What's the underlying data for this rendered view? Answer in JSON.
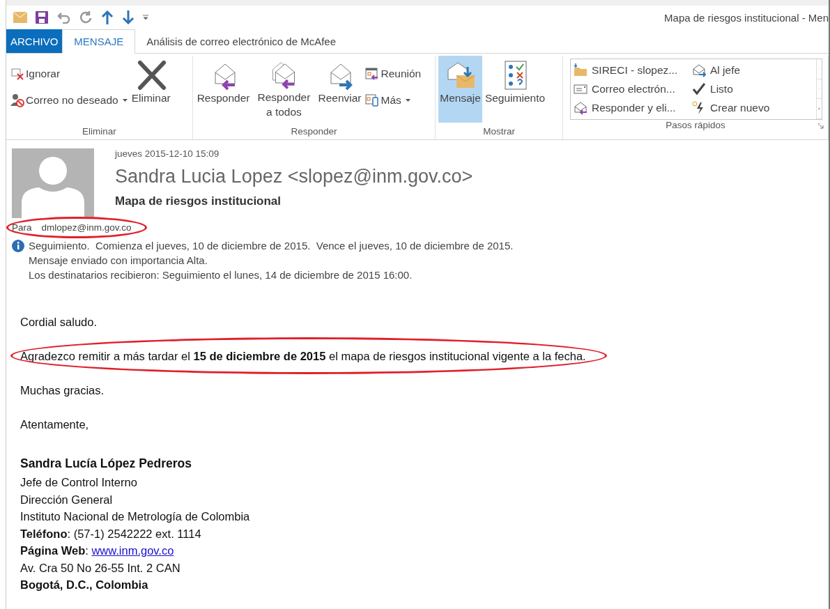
{
  "window": {
    "title": "Mapa de riesgos institucional - Men"
  },
  "tabs": [
    {
      "label": "ARCHIVO",
      "kind": "file",
      "selected": false
    },
    {
      "label": "MENSAJE",
      "kind": "tab",
      "selected": true
    },
    {
      "label": "Análisis de correo electrónico de McAfee",
      "kind": "tab",
      "selected": false
    }
  ],
  "ribbon": {
    "groups": [
      {
        "label": "Eliminar",
        "kind": "buttons",
        "buttons": [
          {
            "kind": "small",
            "label": "Ignorar",
            "dropdown": false
          },
          {
            "kind": "small",
            "label": "Correo no deseado",
            "dropdown": true
          },
          {
            "kind": "large",
            "label": "Eliminar",
            "selected": false
          }
        ]
      },
      {
        "label": "Responder",
        "kind": "buttons",
        "buttons": [
          {
            "kind": "large",
            "label": "Responder",
            "selected": false
          },
          {
            "kind": "large",
            "label": "Responder a todos",
            "selected": false
          },
          {
            "kind": "large",
            "label": "Reenviar",
            "selected": false
          },
          {
            "kind": "small",
            "label": "Reunión",
            "dropdown": false
          },
          {
            "kind": "small",
            "label": "Más",
            "dropdown": true
          }
        ]
      },
      {
        "label": "Mostrar",
        "kind": "buttons",
        "buttons": [
          {
            "kind": "large",
            "label": "Mensaje",
            "selected": true
          },
          {
            "kind": "large",
            "label": "Seguimiento",
            "selected": false
          }
        ]
      },
      {
        "label": "Pasos rápidos",
        "kind": "gallery",
        "items": [
          {
            "label": "SIRECI - slopez..."
          },
          {
            "label": "Al jefe"
          },
          {
            "label": "Correo electrón..."
          },
          {
            "label": "Listo"
          },
          {
            "label": "Responder y eli..."
          },
          {
            "label": "Crear nuevo"
          }
        ]
      }
    ]
  },
  "header": {
    "date": "jueves 2015-12-10 15:09",
    "sender": "Sandra Lucia Lopez <slopez@inm.gov.co>",
    "subject": "Mapa de riesgos institucional",
    "to_label": "Para",
    "to": "dmlopez@inm.gov.co",
    "to_circled": true,
    "info": [
      "Seguimiento.  Comienza el jueves, 10 de diciembre de 2015.  Vence el jueves, 10 de diciembre de 2015.",
      "Mensaje enviado con importancia Alta.",
      "Los destinatarios recibieron: Seguimiento el lunes, 14 de diciembre de 2015 16:00."
    ]
  },
  "body": {
    "paragraphs": [
      {
        "text": "Cordial saludo.",
        "circled": false
      },
      {
        "text": "Agradezco remitir a más tardar el **15 de diciembre de 2015** el mapa de riesgos institucional vigente a la fecha.",
        "circled": true
      },
      {
        "text": "Muchas gracias.",
        "circled": false
      },
      {
        "text": "Atentamente,",
        "circled": false
      }
    ],
    "signature": [
      {
        "kind": "name",
        "text": "Sandra Lucía López Pedreros"
      },
      {
        "kind": "plain",
        "text": "Jefe de Control Interno"
      },
      {
        "kind": "plain",
        "text": "Dirección General"
      },
      {
        "kind": "plain",
        "text": "Instituto Nacional de Metrología de Colombia"
      },
      {
        "kind": "plain",
        "text": "**Teléfono**: (57-1) 2542222 ext. 1114"
      },
      {
        "kind": "link",
        "text": "**Página Web**: ",
        "link": "www.inm.gov.co"
      },
      {
        "kind": "plain",
        "text": "Av. Cra 50 No 26-55 Int. 2 CAN"
      },
      {
        "kind": "name",
        "text": "Bogotá, D.C., Colombia"
      }
    ]
  }
}
